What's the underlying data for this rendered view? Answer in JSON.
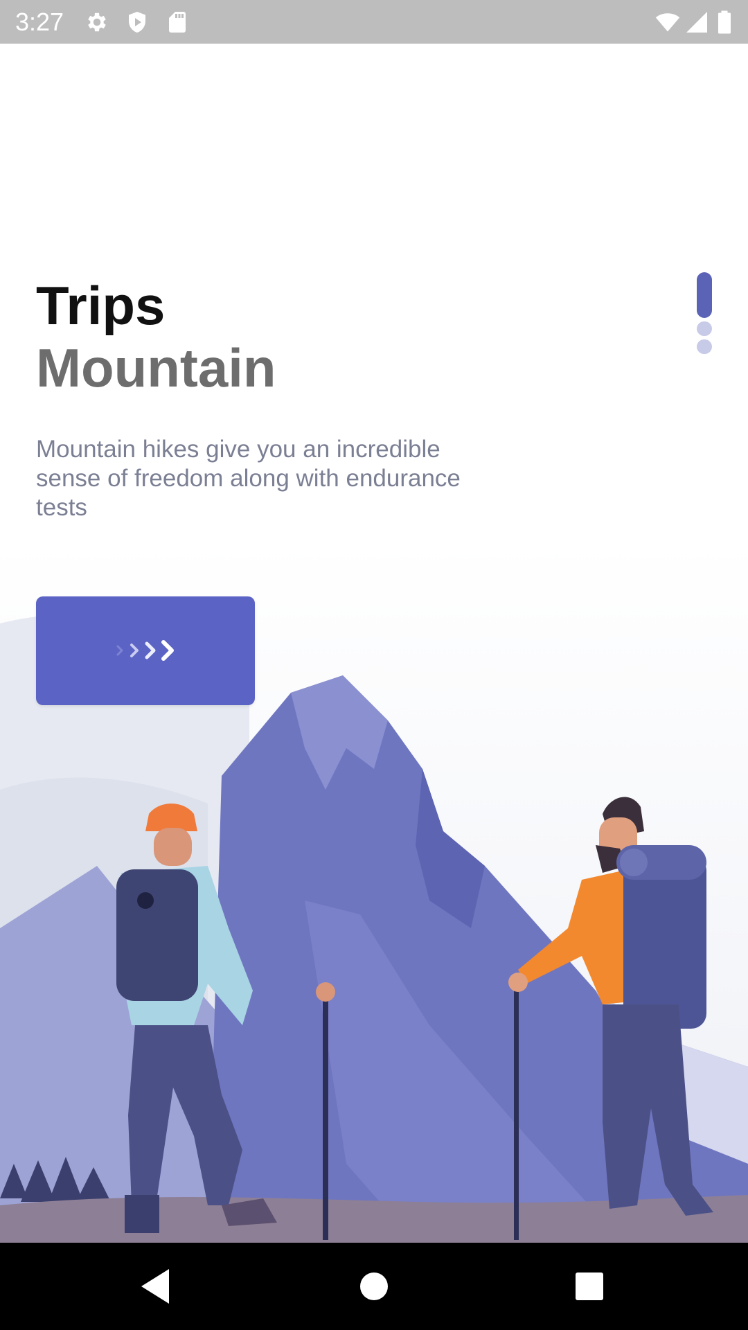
{
  "status_bar": {
    "time": "3:27",
    "left_icons": [
      "gear-icon",
      "shield-icon",
      "sd-card-icon"
    ],
    "right_icons": [
      "wifi-icon",
      "cell-signal-icon",
      "battery-icon"
    ]
  },
  "onboarding": {
    "title": "Trips",
    "subtitle": "Mountain",
    "description": "Mountain hikes give you an incredible sense of freedom along with endurance tests",
    "next_button_icon": "chevrons-right-icon",
    "pager": {
      "total": 3,
      "active_index": 0
    },
    "illustration": "hikers-mountain-illustration"
  },
  "navigation_bar": {
    "buttons": [
      "back-icon",
      "home-icon",
      "recents-icon"
    ]
  },
  "colors": {
    "accent": "#5b63c4",
    "title": "#111111",
    "subtitle": "#6d6d6d",
    "body_text": "#7b7f93",
    "status_bar": "#bdbdbd"
  }
}
